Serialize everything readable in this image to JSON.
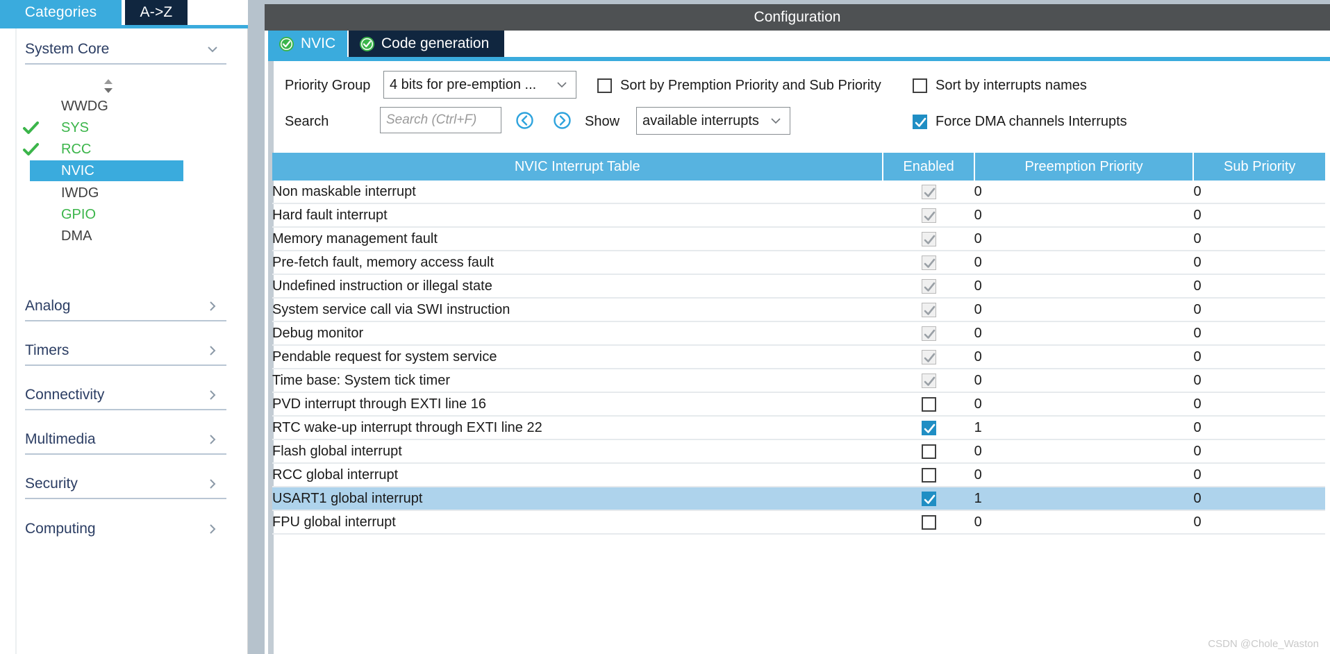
{
  "left_panel": {
    "tabs": [
      {
        "label": "Categories",
        "active": true
      },
      {
        "label": "A->Z",
        "active": false
      }
    ],
    "system_core": {
      "title": "System Core",
      "items": [
        {
          "label": "WWDG",
          "state": "plain"
        },
        {
          "label": "SYS",
          "state": "configured"
        },
        {
          "label": "RCC",
          "state": "configured"
        },
        {
          "label": "NVIC",
          "state": "selected"
        },
        {
          "label": "IWDG",
          "state": "plain"
        },
        {
          "label": "GPIO",
          "state": "green"
        },
        {
          "label": "DMA",
          "state": "plain"
        }
      ]
    },
    "categories": [
      {
        "label": "Analog"
      },
      {
        "label": "Timers"
      },
      {
        "label": "Connectivity"
      },
      {
        "label": "Multimedia"
      },
      {
        "label": "Security"
      },
      {
        "label": "Computing"
      }
    ]
  },
  "config": {
    "window_title": "Configuration",
    "tabs": [
      {
        "label": "NVIC",
        "active": true,
        "icon": "check-circle-icon"
      },
      {
        "label": "Code generation",
        "active": false,
        "icon": "check-circle-icon"
      }
    ],
    "priority_group": {
      "label": "Priority Group",
      "value": "4 bits for pre-emption ..."
    },
    "sort_by_premption": {
      "label": "Sort by Premption Priority and Sub Priority",
      "checked": false
    },
    "sort_by_names": {
      "label": "Sort by interrupts names",
      "checked": false
    },
    "search": {
      "label": "Search",
      "value": "",
      "placeholder": "Search (Ctrl+F)"
    },
    "show": {
      "label": "Show",
      "value": "available interrupts"
    },
    "force_dma": {
      "label": "Force DMA channels Interrupts",
      "checked": true
    },
    "table": {
      "headers": [
        "NVIC Interrupt Table",
        "Enabled",
        "Preemption Priority",
        "Sub Priority"
      ],
      "rows": [
        {
          "name": "Non maskable interrupt",
          "enabled": true,
          "locked": true,
          "preemption": "0",
          "sub": "0",
          "dim": true,
          "highlight": false
        },
        {
          "name": "Hard fault interrupt",
          "enabled": true,
          "locked": true,
          "preemption": "0",
          "sub": "0",
          "dim": true,
          "highlight": false
        },
        {
          "name": "Memory management fault",
          "enabled": true,
          "locked": true,
          "preemption": "0",
          "sub": "0",
          "dim": false,
          "highlight": false
        },
        {
          "name": "Pre-fetch fault, memory access fault",
          "enabled": true,
          "locked": true,
          "preemption": "0",
          "sub": "0",
          "dim": false,
          "highlight": false
        },
        {
          "name": "Undefined instruction or illegal state",
          "enabled": true,
          "locked": true,
          "preemption": "0",
          "sub": "0",
          "dim": false,
          "highlight": false
        },
        {
          "name": "System service call via SWI instruction",
          "enabled": true,
          "locked": true,
          "preemption": "0",
          "sub": "0",
          "dim": false,
          "highlight": false
        },
        {
          "name": "Debug monitor",
          "enabled": true,
          "locked": true,
          "preemption": "0",
          "sub": "0",
          "dim": false,
          "highlight": false
        },
        {
          "name": "Pendable request for system service",
          "enabled": true,
          "locked": true,
          "preemption": "0",
          "sub": "0",
          "dim": false,
          "highlight": false
        },
        {
          "name": "Time base: System tick timer",
          "enabled": true,
          "locked": true,
          "preemption": "0",
          "sub": "0",
          "dim": false,
          "highlight": false
        },
        {
          "name": "PVD interrupt through EXTI line 16",
          "enabled": false,
          "locked": false,
          "preemption": "0",
          "sub": "0",
          "dim": false,
          "highlight": false
        },
        {
          "name": "RTC wake-up interrupt through EXTI line 22",
          "enabled": true,
          "locked": false,
          "preemption": "1",
          "sub": "0",
          "dim": false,
          "highlight": false
        },
        {
          "name": "Flash global interrupt",
          "enabled": false,
          "locked": false,
          "preemption": "0",
          "sub": "0",
          "dim": false,
          "highlight": false
        },
        {
          "name": "RCC global interrupt",
          "enabled": false,
          "locked": false,
          "preemption": "0",
          "sub": "0",
          "dim": false,
          "highlight": false
        },
        {
          "name": "USART1 global interrupt",
          "enabled": true,
          "locked": false,
          "preemption": "1",
          "sub": "0",
          "dim": false,
          "highlight": true
        },
        {
          "name": "FPU global interrupt",
          "enabled": false,
          "locked": false,
          "preemption": "0",
          "sub": "0",
          "dim": false,
          "highlight": false
        }
      ]
    }
  },
  "watermark": "CSDN @Chole_Waston",
  "colors": {
    "accent_blue": "#3aabdd",
    "dark_navy": "#10263f",
    "header_blue": "#57b3e0",
    "title_gray": "#4e5153",
    "green": "#3bb54a",
    "row_highlight": "#aed3ec"
  }
}
